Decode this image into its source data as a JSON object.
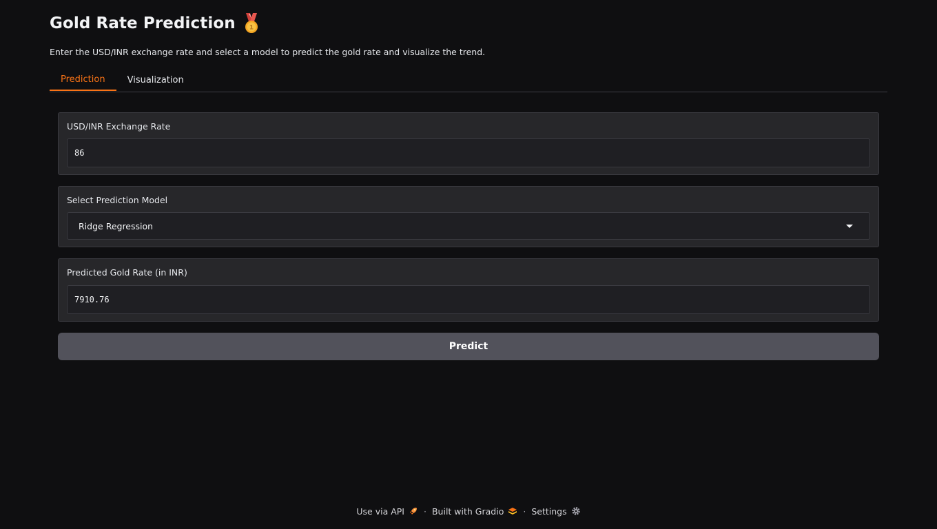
{
  "header": {
    "title": "Gold Rate Prediction",
    "title_icon": "medal-icon",
    "subtitle": "Enter the USD/INR exchange rate and select a model to predict the gold rate and visualize the trend."
  },
  "tabs": [
    {
      "label": "Prediction",
      "active": true
    },
    {
      "label": "Visualization",
      "active": false
    }
  ],
  "exchange_rate": {
    "label": "USD/INR Exchange Rate",
    "value": "86"
  },
  "model_select": {
    "label": "Select Prediction Model",
    "selected": "Ridge Regression",
    "icon": "chevron-down-icon"
  },
  "prediction_output": {
    "label": "Predicted Gold Rate (in INR)",
    "value": "7910.76"
  },
  "predict_button": {
    "label": "Predict"
  },
  "footer": {
    "api_label": "Use via API",
    "api_icon": "rocket-icon",
    "separator": "·",
    "built_label": "Built with Gradio",
    "built_icon": "gradio-logo-icon",
    "settings_label": "Settings",
    "settings_icon": "gear-icon"
  },
  "colors": {
    "background": "#0f0f11",
    "panel": "#27272a",
    "accent": "#f97316",
    "button": "#52525b"
  }
}
